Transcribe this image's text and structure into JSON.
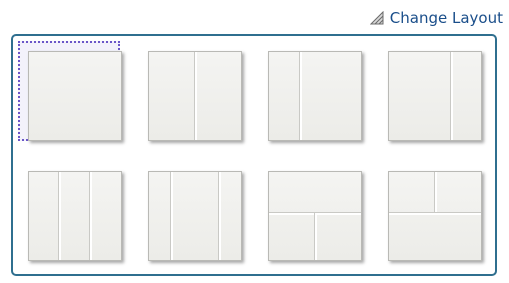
{
  "header": {
    "change_layout_label": "Change Layout",
    "icon": "resize-corner-icon",
    "link_color": "#1a4e8a"
  },
  "layouts": [
    {
      "name": "single-column",
      "selected": true
    },
    {
      "name": "two-equal-columns",
      "selected": false
    },
    {
      "name": "narrow-left-wide-right",
      "selected": false
    },
    {
      "name": "wide-left-narrow-right",
      "selected": false
    },
    {
      "name": "three-equal-columns",
      "selected": false
    },
    {
      "name": "narrow-wide-narrow-columns",
      "selected": false
    },
    {
      "name": "top-row-bottom-two-columns",
      "selected": false
    },
    {
      "name": "top-two-columns-bottom-row",
      "selected": false
    }
  ],
  "colors": {
    "panel_border": "#2f6f8f",
    "selection": "#6a56c8"
  }
}
